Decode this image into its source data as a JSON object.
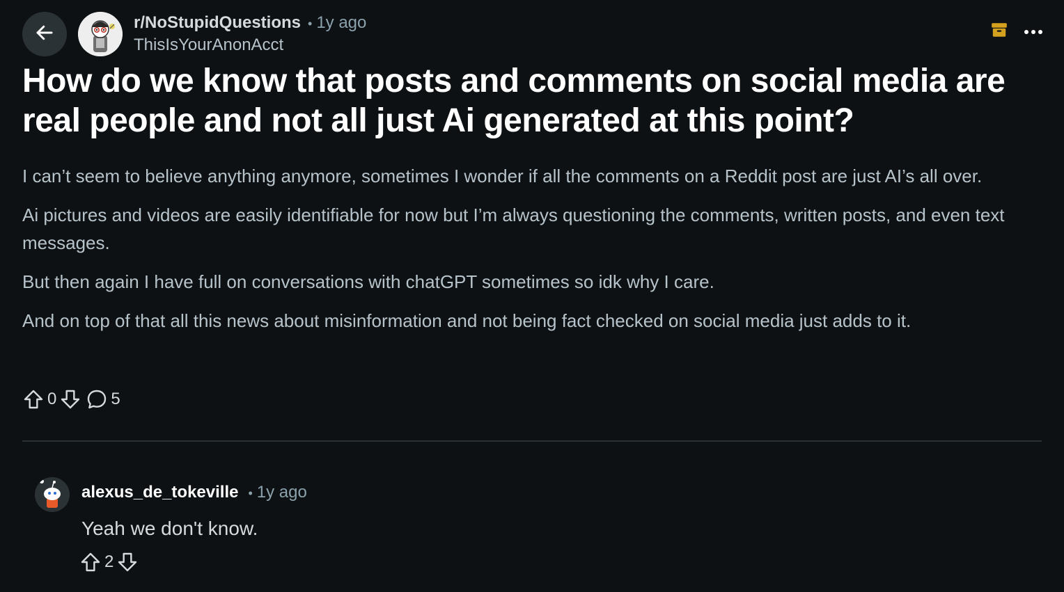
{
  "post": {
    "subreddit": "r/NoStupidQuestions",
    "separator": "•",
    "time": "1y ago",
    "author": "ThisIsYourAnonAcct",
    "title": "How do we know that posts and comments on social media are real people and not all just Ai generated at this point?",
    "paragraphs": [
      "I can’t seem to believe anything anymore, sometimes I wonder if all the comments on a Reddit post are just AI’s all over.",
      "Ai pictures and videos are easily identifiable for now but I’m always questioning the comments, written posts, and even text messages.",
      "But then again I have full on conversations with chatGPT sometimes so idk why I care.",
      "And on top of that all this news about misinformation and not being fact checked on social media just adds to it."
    ],
    "votes": "0",
    "comments_count": "5"
  },
  "comment": {
    "author": "alexus_de_tokeville",
    "separator": "•",
    "time": "1y ago",
    "body": "Yeah we don't know.",
    "votes": "2"
  },
  "icons": {
    "back": "arrow-left-icon",
    "archive": "archive-icon",
    "more": "more-horizontal-icon",
    "upvote": "upvote-arrow-icon",
    "downvote": "downvote-arrow-icon",
    "comment": "comment-bubble-icon"
  },
  "colors": {
    "background": "#0e1113",
    "title": "#ffffff",
    "body": "#b7c3cb",
    "muted": "#8ba2ad",
    "archive_accent": "#d4a11e",
    "divider": "#2a3236"
  }
}
